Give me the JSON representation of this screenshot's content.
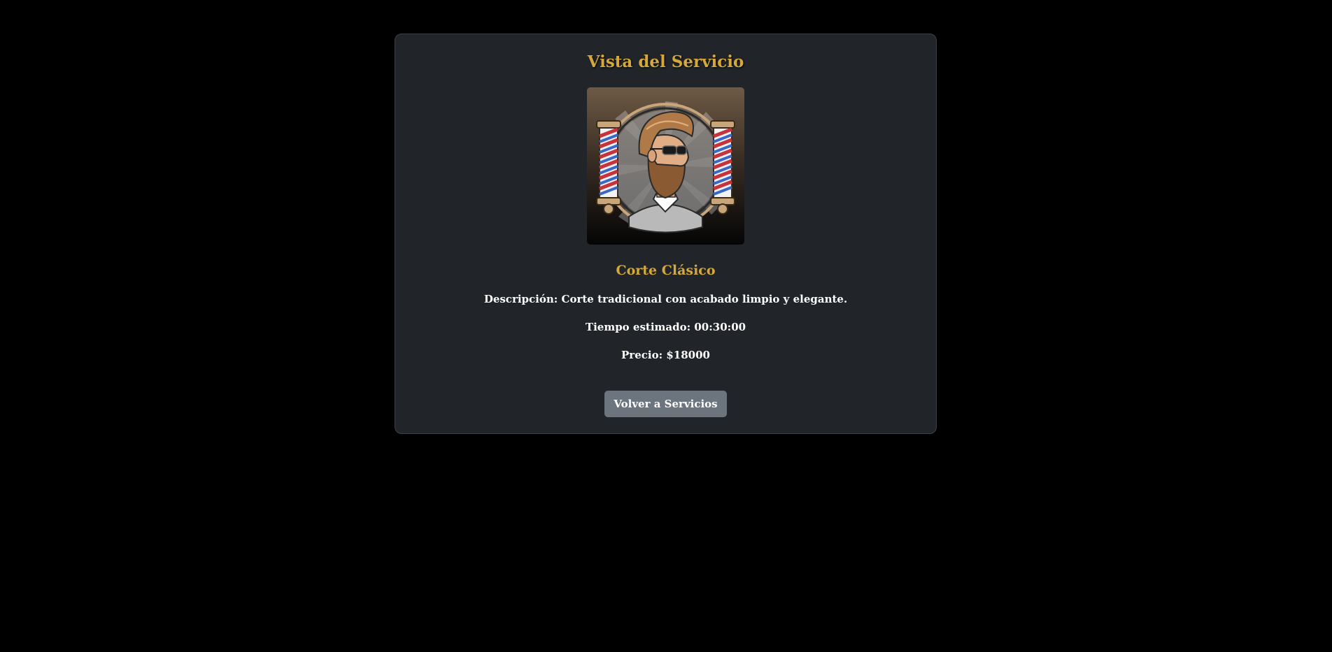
{
  "page": {
    "title": "Vista del Servicio"
  },
  "service": {
    "name": "Corte Clásico",
    "description_text": "Descripción: Corte tradicional con acabado limpio y elegante.",
    "time_text": "Tiempo estimado: 00:30:00",
    "price_text": "Precio: $18000",
    "image_icon": "barber-logo-icon"
  },
  "actions": {
    "back_label": "Volver a Servicios"
  },
  "colors": {
    "background": "#000000",
    "card": "#212529",
    "accent": "#d4a83a",
    "button": "#6c757d",
    "text": "#ffffff"
  }
}
